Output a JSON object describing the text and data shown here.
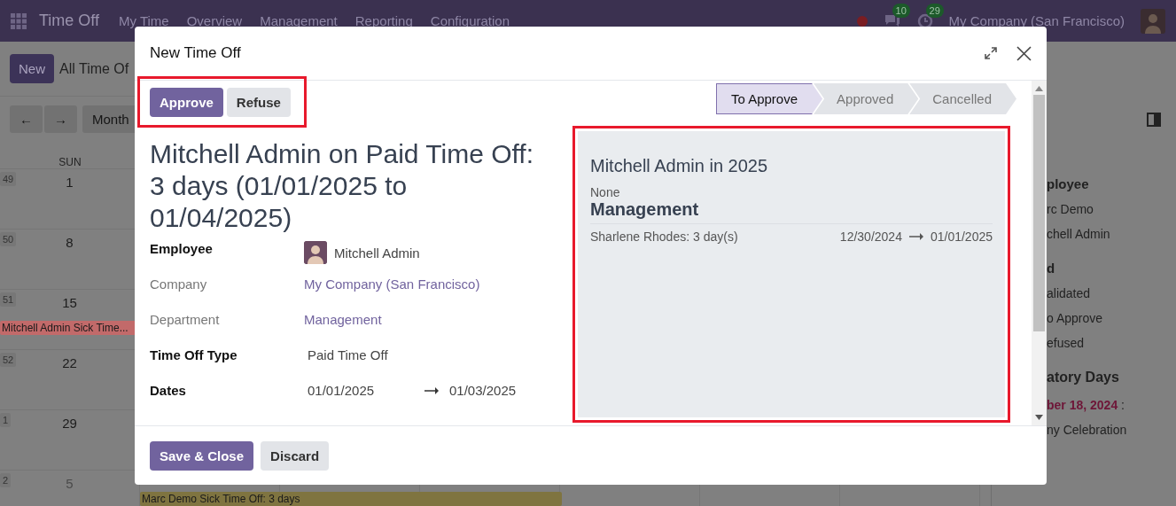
{
  "navbar": {
    "app_name": "Time Off",
    "menu": [
      "My Time",
      "Overview",
      "Management",
      "Reporting",
      "Configuration"
    ],
    "messages_badge": "10",
    "activities_badge": "29",
    "company": "My Company (San Francisco)"
  },
  "control_panel": {
    "new_button": "New",
    "breadcrumb": "All Time Of",
    "prev_button": "←",
    "next_button": "→",
    "scale_button": "Month"
  },
  "calendar": {
    "day_header": "SUN",
    "weeks": [
      {
        "week": "49",
        "day": "1",
        "other_month": false
      },
      {
        "week": "50",
        "day": "8",
        "other_month": false
      },
      {
        "week": "51",
        "day": "15",
        "other_month": false,
        "events": [
          {
            "label": "Mitchell Admin Sick Time...",
            "color": "#c26a6a",
            "kind": "single"
          }
        ]
      },
      {
        "week": "52",
        "day": "22",
        "other_month": false
      },
      {
        "week": "1",
        "day": "29",
        "other_month": false
      },
      {
        "week": "2",
        "day": "5",
        "other_month": true,
        "events": [
          {
            "label": "Marc Demo Sick Time Off: 3 days",
            "color": "#7f7440",
            "kind": "span"
          }
        ]
      }
    ]
  },
  "side_panel": {
    "sections": [
      {
        "heading": "ployee",
        "items": [
          "rc Demo",
          "chell Admin"
        ]
      },
      {
        "heading": "d",
        "items": [
          "alidated",
          "o Approve",
          "efused"
        ]
      },
      {
        "heading": "atory Days",
        "items": [
          "**ber 18, 2024** :",
          "ny Celebration"
        ]
      }
    ]
  },
  "dialog": {
    "title": "New Time Off",
    "actions": [
      {
        "label": "Approve",
        "kind": "primary"
      },
      {
        "label": "Refuse",
        "kind": "secondary"
      }
    ],
    "statusbar": [
      {
        "label": "To Approve",
        "selected": true
      },
      {
        "label": "Approved",
        "selected": false
      },
      {
        "label": "Cancelled",
        "selected": false
      }
    ],
    "record_title": "Mitchell Admin on Paid Time Off: 3 days (01/01/2025 to 01/04/2025)",
    "fields": [
      {
        "label": "Employee",
        "required": true,
        "kind": "avatar",
        "value": "Mitchell Admin"
      },
      {
        "label": "Company",
        "required": false,
        "kind": "link",
        "value": "My Company (San Francisco)"
      },
      {
        "label": "Department",
        "required": false,
        "kind": "link",
        "value": "Management"
      },
      {
        "label": "Time Off Type",
        "required": true,
        "kind": "text",
        "value": "Paid Time Off"
      },
      {
        "label": "Dates",
        "required": true,
        "kind": "daterange",
        "from": "01/01/2025",
        "to": "01/03/2025"
      }
    ],
    "allocation_panel": {
      "title": "Mitchell Admin in 2025",
      "subtitle": "None",
      "group": "Management",
      "rows": [
        {
          "name": "Sharlene Rhodes: 3 day(s)",
          "from": "12/30/2024",
          "to": "01/01/2025"
        }
      ]
    },
    "footer_buttons": [
      {
        "label": "Save & Close",
        "kind": "primary"
      },
      {
        "label": "Discard",
        "kind": "secondary"
      }
    ]
  }
}
